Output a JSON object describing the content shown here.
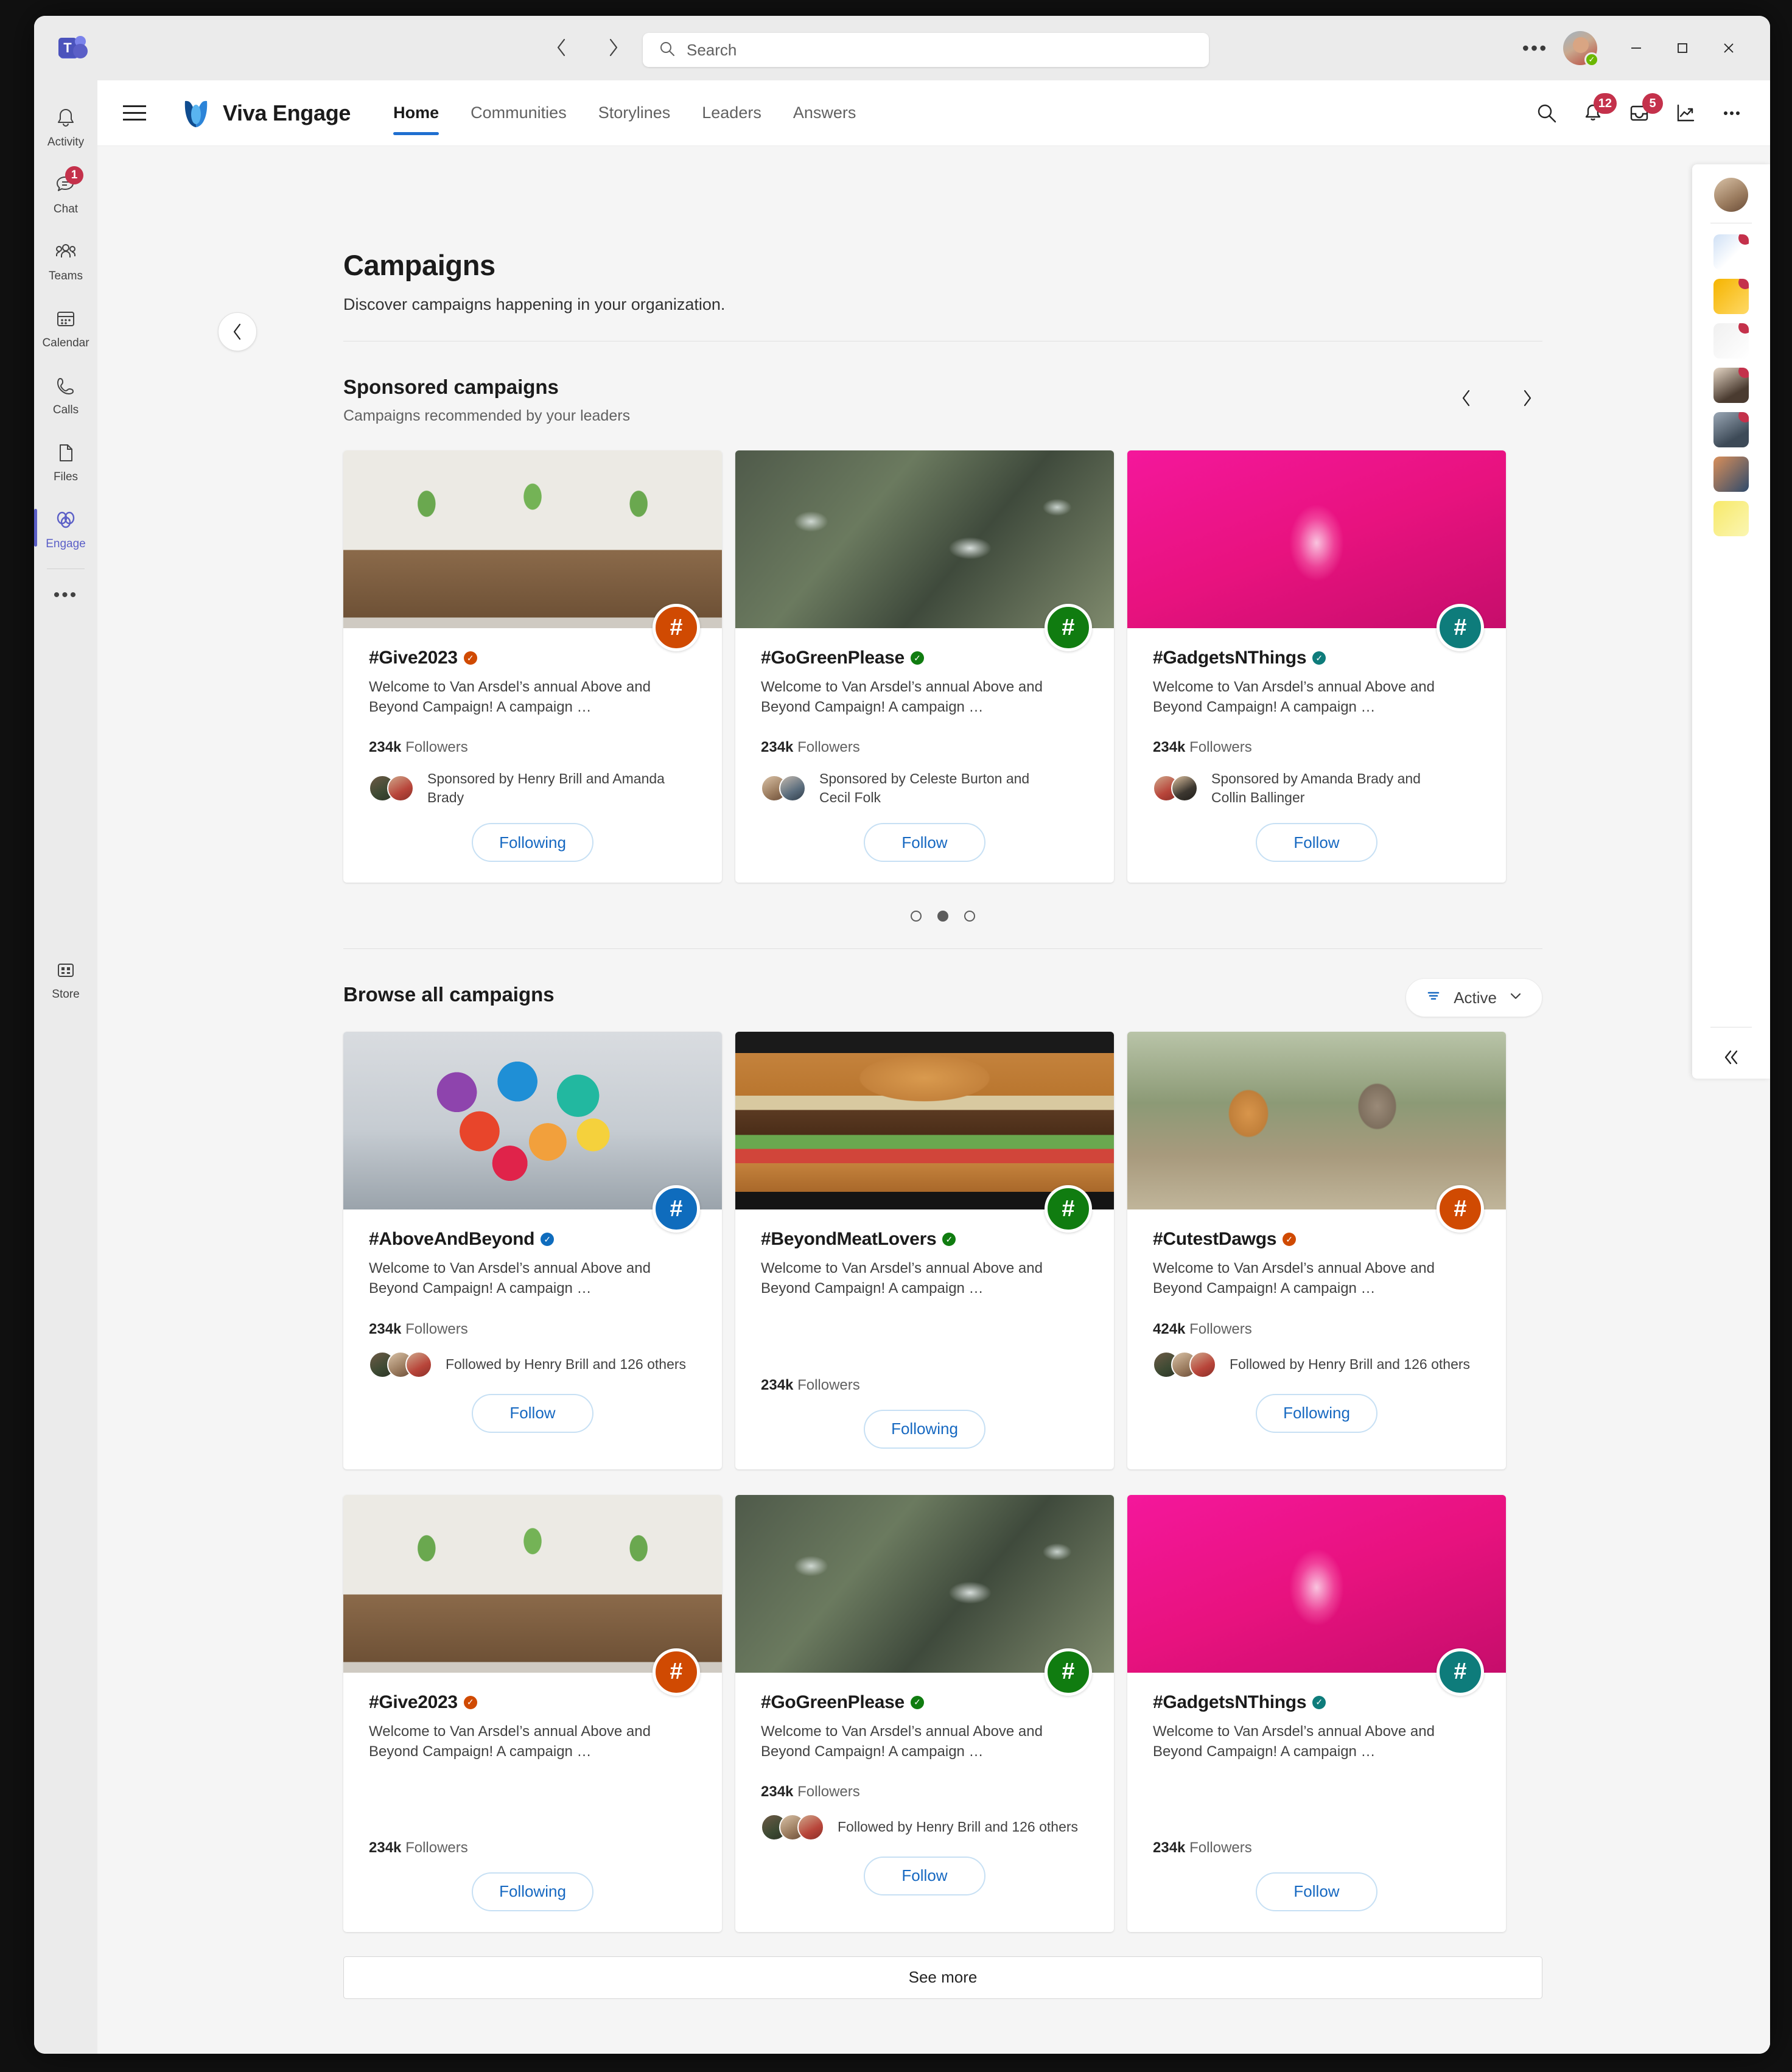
{
  "titlebar": {
    "back_icon": "chevron-left-icon",
    "forward_icon": "chevron-right-icon",
    "search_placeholder": "Search",
    "more_label": "•••",
    "minimize_label": "—",
    "maximize_label": "☐",
    "close_label": "✕"
  },
  "rail": {
    "items": [
      {
        "label": "Activity",
        "icon": "bell-icon",
        "badge": ""
      },
      {
        "label": "Chat",
        "icon": "chat-icon",
        "badge": "1"
      },
      {
        "label": "Teams",
        "icon": "people-icon",
        "badge": ""
      },
      {
        "label": "Calendar",
        "icon": "calendar-icon",
        "badge": ""
      },
      {
        "label": "Calls",
        "icon": "phone-icon",
        "badge": ""
      },
      {
        "label": "Files",
        "icon": "file-icon",
        "badge": ""
      },
      {
        "label": "Engage",
        "icon": "engage-icon",
        "badge": ""
      }
    ],
    "more_label": "•••",
    "store": {
      "label": "Store",
      "icon": "store-icon"
    }
  },
  "header": {
    "app_name": "Viva Engage",
    "menu_icon": "hamburger-icon",
    "logo_icon": "viva-engage-logo-icon",
    "tabs": [
      {
        "label": "Home",
        "active": true
      },
      {
        "label": "Communities",
        "active": false
      },
      {
        "label": "Storylines",
        "active": false
      },
      {
        "label": "Leaders",
        "active": false
      },
      {
        "label": "Answers",
        "active": false
      }
    ],
    "actions": [
      {
        "icon": "search-icon",
        "badge": ""
      },
      {
        "icon": "bell-icon",
        "badge": "12"
      },
      {
        "icon": "inbox-icon",
        "badge": "5"
      },
      {
        "icon": "analytics-icon",
        "badge": ""
      },
      {
        "icon": "more-icon",
        "badge": ""
      }
    ]
  },
  "page": {
    "back_button_icon": "chevron-left-icon",
    "title": "Campaigns",
    "subtitle": "Discover campaigns happening in your organization."
  },
  "sponsored": {
    "title": "Sponsored campaigns",
    "subtitle": "Campaigns recommended by your leaders",
    "prev_icon": "chevron-left-icon",
    "next_icon": "chevron-right-icon",
    "dots": {
      "count": 3,
      "active_index": 1
    },
    "cards": [
      {
        "name": "#Give2023",
        "description": "Welcome to Van Arsdel’s annual Above and Beyond Campaign! A campaign …",
        "followers_count": "234k",
        "followers_label": "Followers",
        "people_text": "Sponsored by Henry Brill and Amanda Brady",
        "button_label": "Following",
        "accent": "#d04a02",
        "image": "img-plants",
        "faces": [
          "ph-face-1",
          "ph-face-2"
        ]
      },
      {
        "name": "#GoGreenPlease",
        "description": "Welcome to Van Arsdel’s annual Above and Beyond Campaign! A campaign …",
        "followers_count": "234k",
        "followers_label": "Followers",
        "people_text": "Sponsored by Celeste Burton and Cecil Folk",
        "button_label": "Follow",
        "accent": "#107c10",
        "image": "img-trash",
        "faces": [
          "ph-face-3",
          "ph-face-4"
        ]
      },
      {
        "name": "#GadgetsNThings",
        "description": "Welcome to Van Arsdel’s annual Above and Beyond Campaign! A campaign …",
        "followers_count": "234k",
        "followers_label": "Followers",
        "people_text": "Sponsored by Amanda Brady and Collin Ballinger",
        "button_label": "Follow",
        "accent": "#0e7c7b",
        "image": "img-bulb",
        "faces": [
          "ph-face-2",
          "ph-face-5"
        ]
      }
    ]
  },
  "browse": {
    "title": "Browse all campaigns",
    "filter": {
      "icon": "filter-icon",
      "label": "Active",
      "chevron": "chevron-down-icon"
    },
    "see_more_label": "See more",
    "cards": [
      {
        "name": "#AboveAndBeyond",
        "description": "Welcome to Van Arsdel’s annual Above and Beyond Campaign! A campaign …",
        "followers_count": "234k",
        "followers_label": "Followers",
        "people_text": "Followed by Henry Brill and 126 others",
        "has_people": true,
        "button_label": "Follow",
        "accent": "#0f6cbd",
        "image": "img-balloons",
        "faces": [
          "ph-face-1",
          "ph-face-3",
          "ph-face-2"
        ]
      },
      {
        "name": "#BeyondMeatLovers",
        "description": "Welcome to Van Arsdel’s annual Above and Beyond Campaign! A campaign …",
        "followers_count": "234k",
        "followers_label": "Followers",
        "people_text": "",
        "has_people": false,
        "button_label": "Following",
        "accent": "#107c10",
        "image": "img-burger",
        "faces": []
      },
      {
        "name": "#CutestDawgs",
        "description": "Welcome to Van Arsdel’s annual Above and Beyond Campaign! A campaign …",
        "followers_count": "424k",
        "followers_label": "Followers",
        "people_text": "Followed by Henry Brill and 126 others",
        "has_people": true,
        "button_label": "Following",
        "accent": "#d04a02",
        "image": "img-dogs",
        "faces": [
          "ph-face-1",
          "ph-face-3",
          "ph-face-2"
        ]
      },
      {
        "name": "#Give2023",
        "description": "Welcome to Van Arsdel’s annual Above and Beyond Campaign! A campaign …",
        "followers_count": "234k",
        "followers_label": "Followers",
        "people_text": "",
        "has_people": false,
        "button_label": "Following",
        "accent": "#d04a02",
        "image": "img-plants",
        "faces": []
      },
      {
        "name": "#GoGreenPlease",
        "description": "Welcome to Van Arsdel’s annual Above and Beyond Campaign! A campaign …",
        "followers_count": "234k",
        "followers_label": "Followers",
        "people_text": "Followed by Henry Brill and 126 others",
        "has_people": true,
        "button_label": "Follow",
        "accent": "#107c10",
        "image": "img-trash",
        "faces": [
          "ph-face-1",
          "ph-face-3",
          "ph-face-2"
        ]
      },
      {
        "name": "#GadgetsNThings",
        "description": "Welcome to Van Arsdel’s annual Above and Beyond Campaign! A campaign …",
        "followers_count": "234k",
        "followers_label": "Followers",
        "people_text": "",
        "has_people": false,
        "button_label": "Follow",
        "accent": "#0e7c7b",
        "image": "img-bulb",
        "faces": []
      }
    ]
  },
  "right_rail": {
    "collapse_icon": "chevron-double-left-icon",
    "items": [
      {
        "icon": "copilot-app-icon",
        "style": "rr-1",
        "badge": true
      },
      {
        "icon": "insights-app-icon",
        "style": "rr-2",
        "badge": true
      },
      {
        "icon": "praise-app-icon",
        "style": "rr-3",
        "badge": true
      },
      {
        "icon": "person-app-icon",
        "style": "rr-4",
        "badge": true
      },
      {
        "icon": "meeting-app-icon",
        "style": "rr-5",
        "badge": true
      },
      {
        "icon": "group-app-icon",
        "style": "rr-6",
        "badge": false
      },
      {
        "icon": "notes-app-icon",
        "style": "rr-7",
        "badge": false
      }
    ]
  }
}
